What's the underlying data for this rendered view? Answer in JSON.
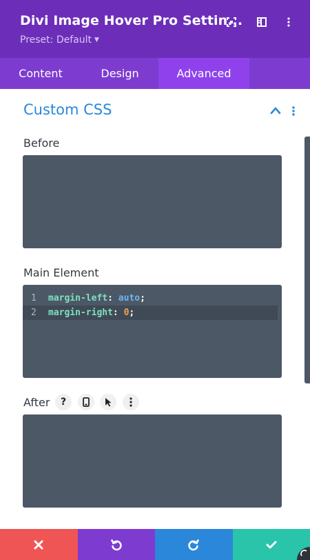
{
  "header": {
    "title": "Divi Image Hover Pro Settin...",
    "preset_label": "Preset: Default",
    "icons": [
      "focus-icon",
      "sidebar-toggle-icon",
      "more-vertical-icon"
    ]
  },
  "tabs": [
    {
      "label": "Content",
      "active": false
    },
    {
      "label": "Design",
      "active": false
    },
    {
      "label": "Advanced",
      "active": true
    }
  ],
  "section": {
    "title": "Custom CSS",
    "icons": [
      "chevron-up-icon",
      "more-vertical-icon"
    ]
  },
  "fields": {
    "before": {
      "label": "Before",
      "value": ""
    },
    "main_element": {
      "label": "Main Element",
      "lines": [
        {
          "num": "1",
          "property": "margin-left",
          "colon": ": ",
          "value": "auto",
          "end": ";"
        },
        {
          "num": "2",
          "property": "margin-right",
          "colon": ": ",
          "value": "0",
          "end": ";"
        }
      ]
    },
    "after": {
      "label": "After",
      "icons": [
        "help-icon",
        "mobile-icon",
        "cursor-icon",
        "more-vertical-icon"
      ],
      "help_glyph": "?",
      "value": ""
    }
  },
  "footer": {
    "buttons": [
      {
        "name": "discard-button",
        "icon": "close-icon",
        "color": "#ef5555"
      },
      {
        "name": "undo-button",
        "icon": "undo-icon",
        "color": "#7e3bd0"
      },
      {
        "name": "redo-button",
        "icon": "redo-icon",
        "color": "#2b87da"
      },
      {
        "name": "save-button",
        "icon": "check-icon",
        "color": "#29c4a9"
      }
    ]
  },
  "colors": {
    "header_bg": "#6c2eb9",
    "tabs_bg": "#7d3bd0",
    "active_tab_bg": "#8f42ec",
    "accent": "#2b87da",
    "editor_bg": "#4c5866"
  }
}
